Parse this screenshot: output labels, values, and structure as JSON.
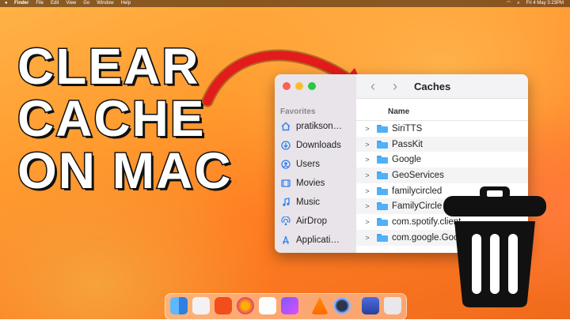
{
  "menubar": {
    "apple": "",
    "menus": [
      "Finder",
      "File",
      "Edit",
      "View",
      "Go",
      "Window",
      "Help"
    ],
    "clock": "Fri 4 May 3:23PM"
  },
  "headline": {
    "line1": "CLEAR",
    "line2": "CACHE",
    "line3": "ON MAC"
  },
  "finder": {
    "title": "Caches",
    "back": "‹",
    "forward": "›",
    "favorites_label": "Favorites",
    "sidebar_items": [
      {
        "label": "pratikson…",
        "icon": "home-icon"
      },
      {
        "label": "Downloads",
        "icon": "downloads-icon"
      },
      {
        "label": "Users",
        "icon": "users-icon"
      },
      {
        "label": "Movies",
        "icon": "movies-icon"
      },
      {
        "label": "Music",
        "icon": "music-icon"
      },
      {
        "label": "AirDrop",
        "icon": "airdrop-icon"
      },
      {
        "label": "Applicati…",
        "icon": "applications-icon"
      }
    ],
    "column_name": "Name",
    "rows": [
      "SiriTTS",
      "PassKit",
      "Google",
      "GeoServices",
      "familycircled",
      "FamilyCircle",
      "com.spotify.client",
      "com.google.GoogleUpdater"
    ]
  },
  "colors": {
    "accent": "#2f7ff0",
    "arrow": "#e41b1b",
    "folder": "#4fb1f7"
  }
}
